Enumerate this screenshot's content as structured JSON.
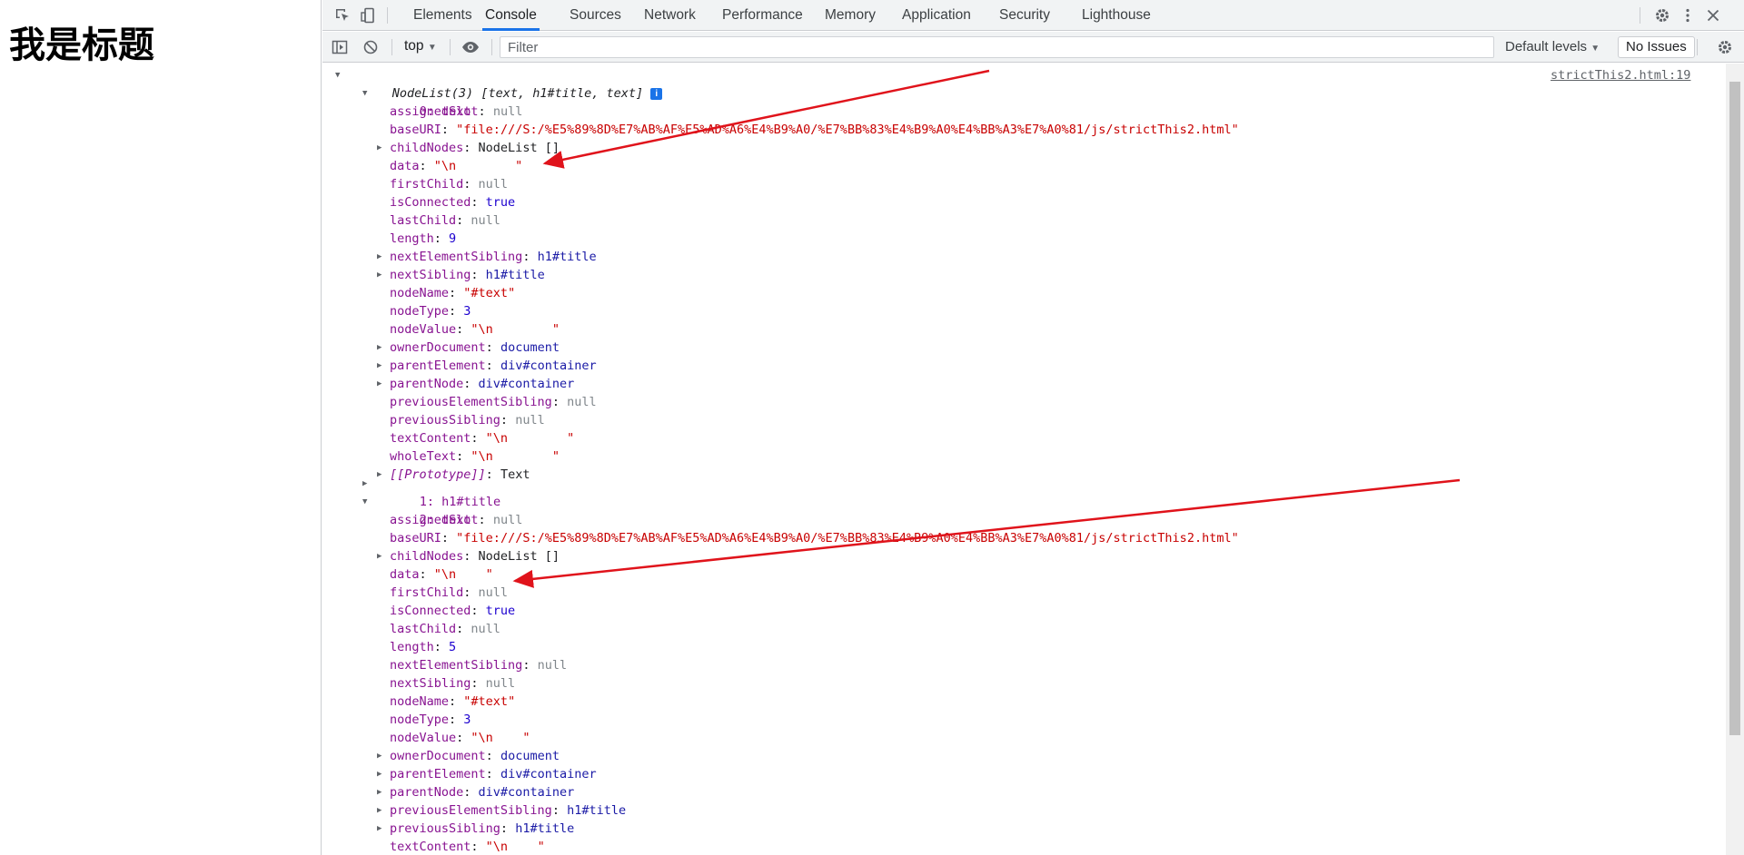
{
  "page": {
    "heading": "我是标题"
  },
  "devtools": {
    "tabs": [
      "Elements",
      "Console",
      "Sources",
      "Network",
      "Performance",
      "Memory",
      "Application",
      "Security",
      "Lighthouse"
    ],
    "active_tab": "Console",
    "console_toolbar": {
      "context": "top",
      "filter_placeholder": "Filter",
      "levels": "Default levels",
      "issues": "No Issues"
    },
    "source_link": "strictThis2.html:19",
    "nodelist_header": {
      "label": "NodeList(3)",
      "preview": "[text, h1#title, text]",
      "info": "i"
    },
    "item0": {
      "label": "0: text",
      "props": [
        {
          "key": "assignedSlot",
          "value": "null",
          "type": "nul",
          "expandable": false
        },
        {
          "key": "baseURI",
          "value": "\"file:///S:/%E5%89%8D%E7%AB%AF%E5%AD%A6%E4%B9%A0/%E7%BB%83%E4%B9%A0%E4%BB%A3%E7%A0%81/js/strictThis2.html\"",
          "type": "str",
          "expandable": false
        },
        {
          "key": "childNodes",
          "value": "NodeList []",
          "type": "obj",
          "expandable": true
        },
        {
          "key": "data",
          "value": "\"\\n        \"",
          "type": "str",
          "expandable": false
        },
        {
          "key": "firstChild",
          "value": "null",
          "type": "nul",
          "expandable": false
        },
        {
          "key": "isConnected",
          "value": "true",
          "type": "bool",
          "expandable": false
        },
        {
          "key": "lastChild",
          "value": "null",
          "type": "nul",
          "expandable": false
        },
        {
          "key": "length",
          "value": "9",
          "type": "num",
          "expandable": false
        },
        {
          "key": "nextElementSibling",
          "value": "h1#title",
          "type": "node",
          "expandable": true
        },
        {
          "key": "nextSibling",
          "value": "h1#title",
          "type": "node",
          "expandable": true
        },
        {
          "key": "nodeName",
          "value": "\"#text\"",
          "type": "str",
          "expandable": false
        },
        {
          "key": "nodeType",
          "value": "3",
          "type": "num",
          "expandable": false
        },
        {
          "key": "nodeValue",
          "value": "\"\\n        \"",
          "type": "str",
          "expandable": false
        },
        {
          "key": "ownerDocument",
          "value": "document",
          "type": "node",
          "expandable": true
        },
        {
          "key": "parentElement",
          "value": "div#container",
          "type": "node",
          "expandable": true
        },
        {
          "key": "parentNode",
          "value": "div#container",
          "type": "node",
          "expandable": true
        },
        {
          "key": "previousElementSibling",
          "value": "null",
          "type": "nul",
          "expandable": false
        },
        {
          "key": "previousSibling",
          "value": "null",
          "type": "nul",
          "expandable": false
        },
        {
          "key": "textContent",
          "value": "\"\\n        \"",
          "type": "str",
          "expandable": false
        },
        {
          "key": "wholeText",
          "value": "\"\\n        \"",
          "type": "str",
          "expandable": false
        },
        {
          "key": "[[Prototype]]",
          "value": "Text",
          "type": "obj",
          "expandable": true,
          "proto": true
        }
      ]
    },
    "item1": {
      "label": "1: h1#title"
    },
    "item2": {
      "label": "2: text",
      "props": [
        {
          "key": "assignedSlot",
          "value": "null",
          "type": "nul",
          "expandable": false
        },
        {
          "key": "baseURI",
          "value": "\"file:///S:/%E5%89%8D%E7%AB%AF%E5%AD%A6%E4%B9%A0/%E7%BB%83%E4%B9%A0%E4%BB%A3%E7%A0%81/js/strictThis2.html\"",
          "type": "str",
          "expandable": false
        },
        {
          "key": "childNodes",
          "value": "NodeList []",
          "type": "obj",
          "expandable": true
        },
        {
          "key": "data",
          "value": "\"\\n    \"",
          "type": "str",
          "expandable": false
        },
        {
          "key": "firstChild",
          "value": "null",
          "type": "nul",
          "expandable": false
        },
        {
          "key": "isConnected",
          "value": "true",
          "type": "bool",
          "expandable": false
        },
        {
          "key": "lastChild",
          "value": "null",
          "type": "nul",
          "expandable": false
        },
        {
          "key": "length",
          "value": "5",
          "type": "num",
          "expandable": false
        },
        {
          "key": "nextElementSibling",
          "value": "null",
          "type": "nul",
          "expandable": false
        },
        {
          "key": "nextSibling",
          "value": "null",
          "type": "nul",
          "expandable": false
        },
        {
          "key": "nodeName",
          "value": "\"#text\"",
          "type": "str",
          "expandable": false
        },
        {
          "key": "nodeType",
          "value": "3",
          "type": "num",
          "expandable": false
        },
        {
          "key": "nodeValue",
          "value": "\"\\n    \"",
          "type": "str",
          "expandable": false
        },
        {
          "key": "ownerDocument",
          "value": "document",
          "type": "node",
          "expandable": true
        },
        {
          "key": "parentElement",
          "value": "div#container",
          "type": "node",
          "expandable": true
        },
        {
          "key": "parentNode",
          "value": "div#container",
          "type": "node",
          "expandable": true
        },
        {
          "key": "previousElementSibling",
          "value": "h1#title",
          "type": "node",
          "expandable": true
        },
        {
          "key": "previousSibling",
          "value": "h1#title",
          "type": "node",
          "expandable": true
        },
        {
          "key": "textContent",
          "value": "\"\\n    \"",
          "type": "str",
          "expandable": false
        }
      ]
    }
  },
  "colors": {
    "accent": "#1a73e8",
    "annotation": "#e0131b"
  },
  "icons": [
    "inspect-icon",
    "device-toggle-icon",
    "settings-gear-icon",
    "more-vert-icon",
    "close-icon",
    "sidebar-toggle-icon",
    "clear-console-icon",
    "eye-icon",
    "console-settings-gear-icon"
  ]
}
